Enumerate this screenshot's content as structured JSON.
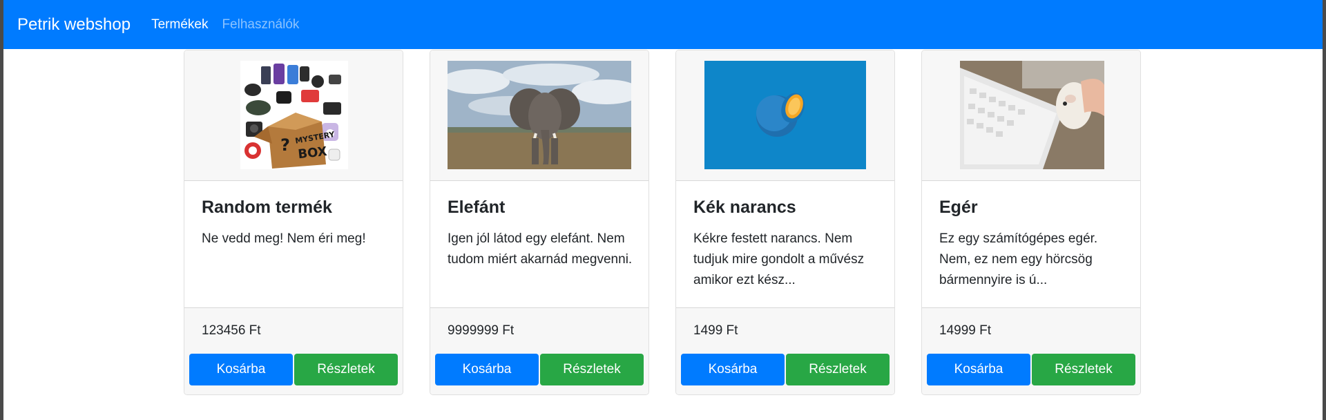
{
  "navbar": {
    "brand": "Petrik webshop",
    "links": [
      {
        "label": "Termékek",
        "active": true
      },
      {
        "label": "Felhasználók",
        "active": false
      }
    ]
  },
  "products": [
    {
      "title": "Random termék",
      "description": "Ne vedd meg! Nem éri meg!",
      "price": "123456 Ft",
      "cart_label": "Kosárba",
      "details_label": "Részletek",
      "image": "mystery-box-image"
    },
    {
      "title": "Elefánt",
      "description": "Igen jól látod egy elefánt. Nem tudom miért akarnád megvenni.",
      "price": "9999999 Ft",
      "cart_label": "Kosárba",
      "details_label": "Részletek",
      "image": "elephant-image"
    },
    {
      "title": "Kék narancs",
      "description": "Kékre festett narancs. Nem tudjuk mire gondolt a művész amikor ezt kész...",
      "price": "1499 Ft",
      "cart_label": "Kosárba",
      "details_label": "Részletek",
      "image": "blue-orange-image"
    },
    {
      "title": "Egér",
      "description": "Ez egy számítógépes egér. Nem, ez nem egy hörcsög bármennyire is ú...",
      "price": "14999 Ft",
      "cart_label": "Kosárba",
      "details_label": "Részletek",
      "image": "hamster-mouse-image"
    }
  ],
  "colors": {
    "navbar": "#007bff",
    "cart_button": "#007bff",
    "details_button": "#28a745"
  }
}
